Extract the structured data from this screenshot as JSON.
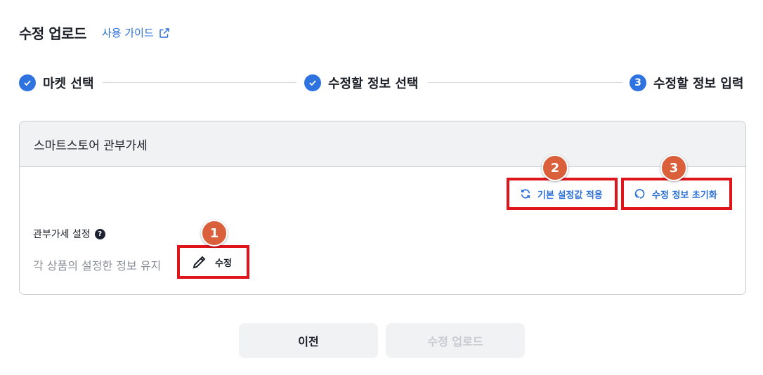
{
  "header": {
    "title": "수정 업로드",
    "guide_label": "사용 가이드"
  },
  "steps": [
    {
      "label": "마켓 선택",
      "state": "done"
    },
    {
      "label": "수정할 정보 선택",
      "state": "done"
    },
    {
      "label": "수정할 정보 입력",
      "state": "current",
      "number": "3"
    }
  ],
  "card": {
    "title": "스마트스토어 관부가세",
    "apply_default_label": "기본 설정값 적용",
    "reset_label": "수정 정보 초기화",
    "field_label": "관부가세 설정",
    "help_glyph": "?",
    "field_value": "각 상품의 설정한 정보 유지",
    "edit_label": "수정"
  },
  "annotations": {
    "badge1": "1",
    "badge2": "2",
    "badge3": "3"
  },
  "footer": {
    "prev_label": "이전",
    "upload_label": "수정 업로드"
  },
  "colors": {
    "accent": "#2f73e0",
    "link": "#2c6fd6",
    "highlight": "#e0141b",
    "badge": "#d9603b"
  },
  "icons": {
    "guide": "external-link-icon",
    "apply": "refresh-icon",
    "reset": "reset-icon",
    "edit": "pencil-icon",
    "step_done": "check-icon",
    "help": "help-icon"
  }
}
